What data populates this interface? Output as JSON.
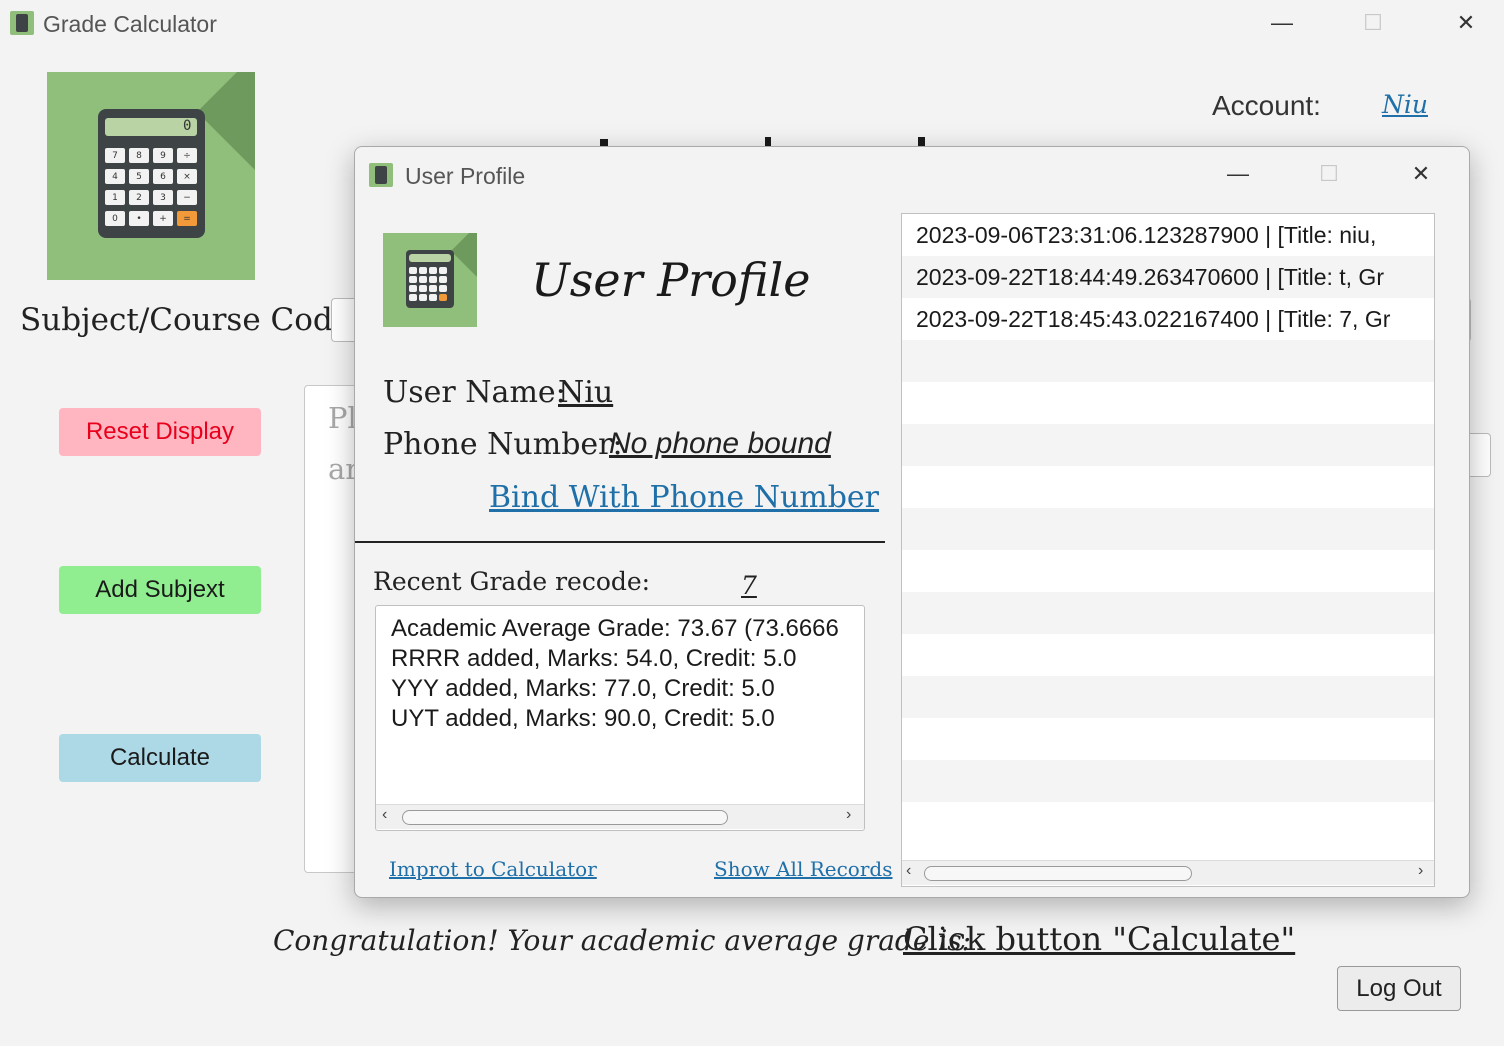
{
  "main_window": {
    "title": "Grade Calculator",
    "account_label": "Account:",
    "account_name": "Niu",
    "subject_label": "Subject/Course Code:",
    "textarea_partial_line1": "Pl",
    "textarea_partial_line2": "ar",
    "buttons": {
      "reset": "Reset Display",
      "add": "Add Subjext",
      "calculate": "Calculate",
      "logout": "Log Out"
    },
    "result_label": "Congratulation! Your academic average grade is:",
    "result_value": "Click button \"Calculate\""
  },
  "calc_keys": [
    "7",
    "8",
    "9",
    "÷",
    "4",
    "5",
    "6",
    "×",
    "1",
    "2",
    "3",
    "−",
    "0",
    "•",
    "+",
    "="
  ],
  "calc_display": "0",
  "dialog": {
    "title": "User Profile",
    "heading": "User Profile",
    "user_name_label": "User Name:",
    "user_name": "Niu",
    "phone_label": "Phone Number:",
    "phone_value": "No phone bound",
    "bind_link": "Bind With Phone Number",
    "recent_label": "Recent Grade recode:",
    "recent_count": "7",
    "recent_lines": [
      "Academic Average Grade: 73.67 (73.6666",
      "RRRR added, Marks: 54.0, Credit: 5.0",
      "YYY added, Marks: 77.0, Credit: 5.0",
      "UYT added, Marks: 90.0, Credit: 5.0"
    ],
    "import_link": "Improt to Calculator",
    "show_all_link": "Show All Records",
    "records": [
      "2023-09-06T23:31:06.123287900 | [Title: niu,",
      "2023-09-22T18:44:49.263470600 | [Title: t, Gr",
      "2023-09-22T18:45:43.022167400 | [Title: 7, Gr"
    ]
  },
  "icons": {
    "minimize": "—",
    "maximize": "☐",
    "close": "✕",
    "left_arrow": "‹",
    "right_arrow": "›"
  },
  "colors": {
    "reset_bg": "#ffb6c1",
    "reset_text": "#e8001c",
    "add_bg": "#90ee90",
    "calculate_bg": "#add8e6",
    "icon_green": "#8fbf7a",
    "link_blue": "#1f6fa8"
  }
}
